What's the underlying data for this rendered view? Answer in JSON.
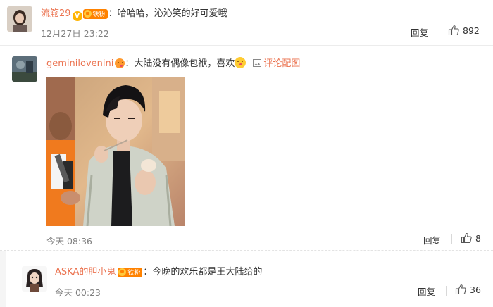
{
  "comments": [
    {
      "username": "流觞29",
      "badge": "铁粉",
      "text": "：哈哈哈，沁沁笑的好可爱哦",
      "time": "12月27日 23:22",
      "reply_label": "回复",
      "likes": "892",
      "verified_mark": "V"
    },
    {
      "username": "geminilovenini",
      "text": "：大陆没有偶像包袱，喜欢",
      "pic_link": "评论配图",
      "time": "今天 08:36",
      "reply_label": "回复",
      "likes": "8"
    },
    {
      "username": "ASKA的胆小鬼",
      "badge": "铁粉",
      "text": "：今晚的欢乐都是王大陆给的",
      "time": "今天 00:23",
      "reply_label": "回复",
      "likes": "36"
    }
  ],
  "colors": {
    "username": "#eb7350",
    "meta": "#808080",
    "badge": "#ff8200"
  }
}
